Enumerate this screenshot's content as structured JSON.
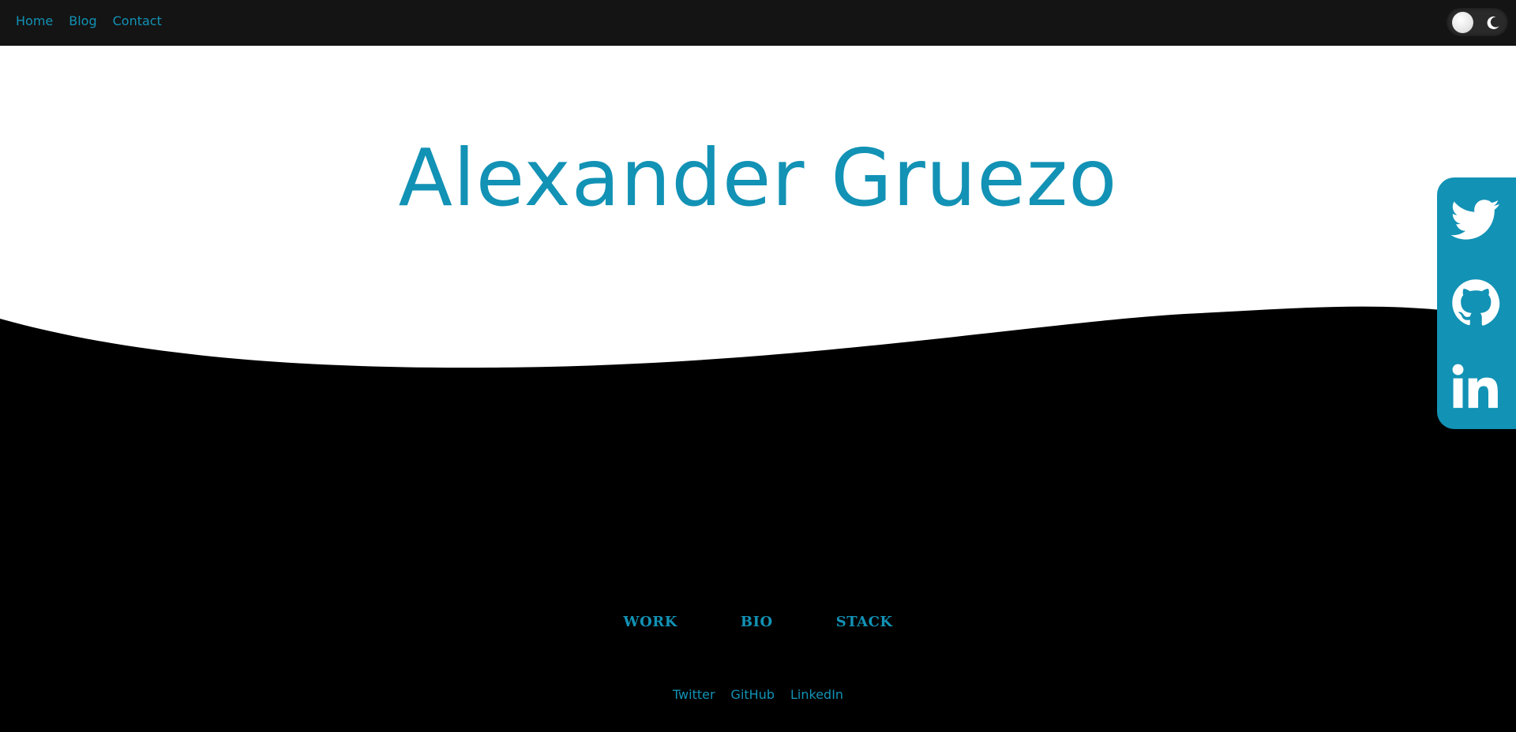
{
  "nav": {
    "links": [
      "Home",
      "Blog",
      "Contact"
    ]
  },
  "theme_toggle": {
    "icons": [
      "toggle-knob",
      "moon-icon"
    ]
  },
  "hero": {
    "title": "Alexander Gruezo"
  },
  "social_sidebar": {
    "icons": [
      "twitter-icon",
      "github-icon",
      "linkedin-icon"
    ]
  },
  "sections": [
    "WORK",
    "BIO",
    "STACK"
  ],
  "footer": {
    "links": [
      "Twitter",
      "GitHub",
      "LinkedIn"
    ]
  },
  "colors": {
    "accent": "#1292b5",
    "navbar_bg": "#141414",
    "hero_bg": "#ffffff",
    "page_bg": "#000000"
  }
}
